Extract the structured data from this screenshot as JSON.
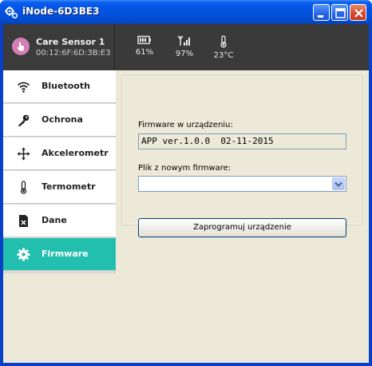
{
  "window": {
    "title": "iNode-6D3BE3"
  },
  "device": {
    "name": "Care Sensor 1",
    "mac": "00:12:6F:6D:3B:E3"
  },
  "stats": [
    {
      "icon": "battery-icon",
      "value": "61%"
    },
    {
      "icon": "signal-icon",
      "value": "97%"
    },
    {
      "icon": "thermometer-icon",
      "value": "23°C"
    }
  ],
  "sidebar": {
    "items": [
      {
        "label": "Bluetooth",
        "icon": "wifi-icon",
        "active": false
      },
      {
        "label": "Ochrona",
        "icon": "key-icon",
        "active": false
      },
      {
        "label": "Akcelerometr",
        "icon": "move-arrows-icon",
        "active": false
      },
      {
        "label": "Termometr",
        "icon": "thermometer-icon",
        "active": false
      },
      {
        "label": "Dane",
        "icon": "file-delete-icon",
        "active": false
      },
      {
        "label": "Firmware",
        "icon": "gear-icon",
        "active": true
      }
    ]
  },
  "firmware": {
    "current_label": "Firmware w urządzeniu:",
    "current_value": "APP ver.1.0.0  02-11-2015",
    "file_label": "Plik z nowym firmware:",
    "file_value": "",
    "program_button": "Zaprogramuj urządzenie"
  },
  "colors": {
    "accent": "#23BFAE",
    "header": "#3A3A3A",
    "avatar": "#D27FB6"
  }
}
